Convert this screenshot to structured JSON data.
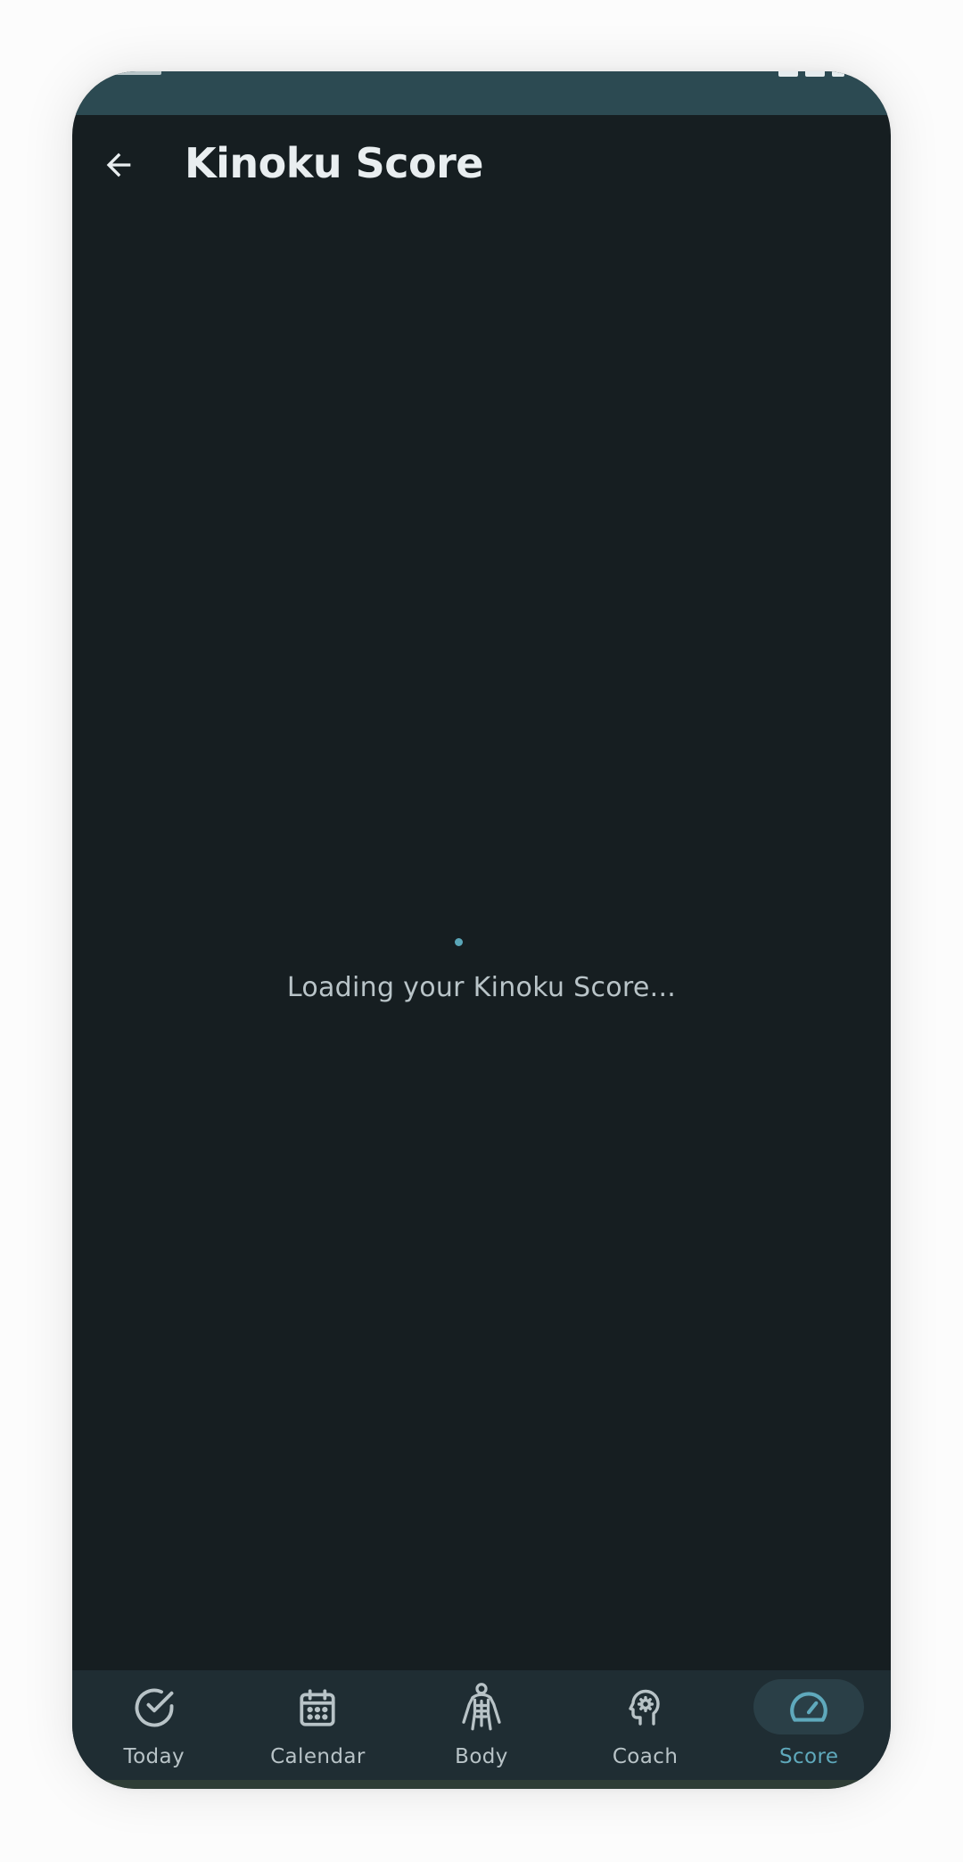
{
  "app_bar": {
    "title": "Kinoku Score"
  },
  "loading": {
    "message": "Loading your Kinoku Score..."
  },
  "bottom_nav": {
    "items": [
      {
        "label": "Today",
        "icon": "check-circle-icon",
        "active": false
      },
      {
        "label": "Calendar",
        "icon": "calendar-icon",
        "active": false
      },
      {
        "label": "Body",
        "icon": "body-icon",
        "active": false
      },
      {
        "label": "Coach",
        "icon": "brain-gear-icon",
        "active": false
      },
      {
        "label": "Score",
        "icon": "speedometer-icon",
        "active": true
      }
    ]
  },
  "colors": {
    "background": "#161e21",
    "status_bar": "#2c4a52",
    "nav_background": "#1f2d33",
    "accent": "#5fa9bc",
    "text_primary": "#e9eef0",
    "text_secondary": "#b8c3c7"
  }
}
